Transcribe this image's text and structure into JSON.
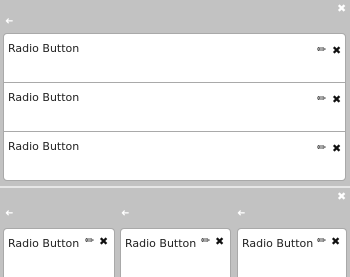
{
  "icons": {
    "close": "✖",
    "back": "➜",
    "edit": "✏",
    "delete": "✖"
  },
  "top_panel": {
    "items": [
      {
        "label": "Radio Button"
      },
      {
        "label": "Radio Button"
      },
      {
        "label": "Radio Button"
      }
    ]
  },
  "bottom_panel": {
    "columns": [
      {
        "label": "Radio Button"
      },
      {
        "label": "Radio Button"
      },
      {
        "label": "Radio Button"
      }
    ]
  }
}
